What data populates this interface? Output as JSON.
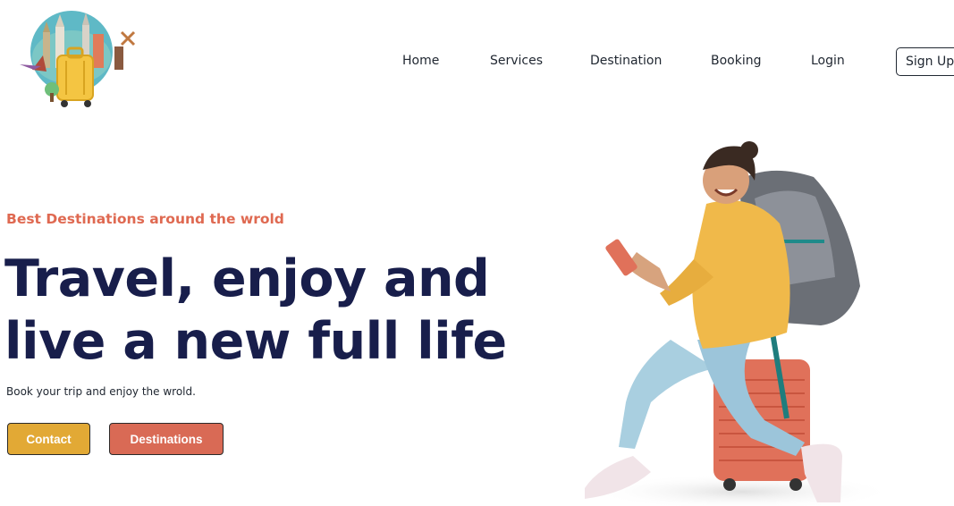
{
  "nav": {
    "items": [
      "Home",
      "Services",
      "Destination",
      "Booking",
      "Login"
    ],
    "signup_label": "Sign Up"
  },
  "hero": {
    "tagline": "Best Destinations around the wrold",
    "headline_line1": "Travel, enjoy and",
    "headline_line2": "live a new full life",
    "subtext": "Book your trip and enjoy the wrold.",
    "contact_label": "Contact",
    "destinations_label": "Destinations"
  },
  "colors": {
    "accent_orange": "#df6951",
    "contact_yellow": "#e2a935",
    "heading_navy": "#181e4b"
  },
  "icons": {
    "logo": "travel-suitcase-globe-logo",
    "hero": "traveler-with-backpack-image"
  }
}
